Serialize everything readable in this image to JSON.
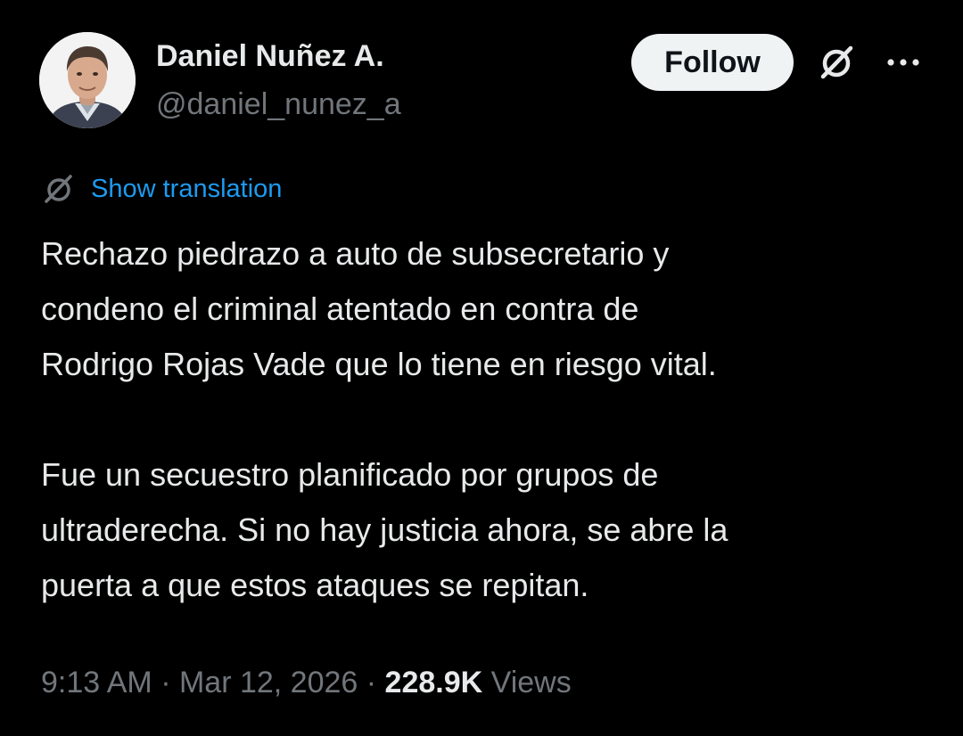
{
  "author": {
    "display_name": "Daniel Nuñez A.",
    "handle": "@daniel_nunez_a"
  },
  "actions": {
    "follow_label": "Follow",
    "grok_icon": "grok-icon",
    "more_icon": "more-icon"
  },
  "translation": {
    "label": "Show translation",
    "icon": "translate-icon"
  },
  "tweet": {
    "paragraphs": [
      "Rechazo piedrazo a auto de subsecretario y\ncondeno el criminal atentado en contra de\nRodrigo Rojas Vade que lo tiene en riesgo vital.",
      "Fue un secuestro planificado por grupos de\nultraderecha. Si no hay justicia ahora, se abre la\npuerta a que estos ataques se repitan."
    ]
  },
  "meta": {
    "time": "9:13 AM",
    "separator": " · ",
    "date": "Mar 12, 2026",
    "views_count": "228.9K",
    "views_label": "Views"
  },
  "colors": {
    "background": "#000000",
    "text": "#e7e9ea",
    "muted": "#71767b",
    "link": "#1d9bf0",
    "follow_bg": "#eff3f4"
  }
}
